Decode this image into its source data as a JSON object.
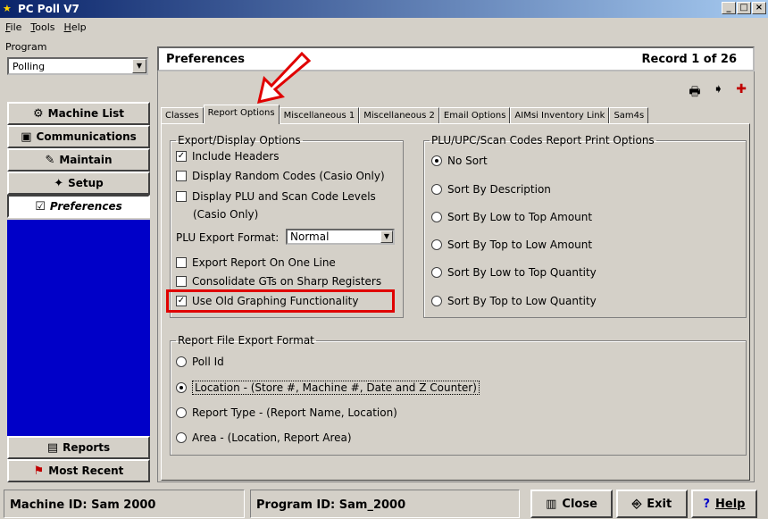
{
  "window": {
    "title": "PC Poll V7",
    "minimize": "_",
    "maximize": "□",
    "close": "×"
  },
  "menu": [
    "File",
    "Tools",
    "Help"
  ],
  "left": {
    "program_label": "Program",
    "program_value": "Polling",
    "nav": [
      "Machine List",
      "Communications",
      "Maintain",
      "Setup",
      "Preferences"
    ],
    "bottom_nav": [
      "Reports",
      "Most Recent"
    ]
  },
  "header": {
    "title": "Preferences",
    "record": "Record  1  of  26"
  },
  "tabs": [
    "Classes",
    "Report Options",
    "Miscellaneous 1",
    "Miscellaneous 2",
    "Email Options",
    "AIMsi Inventory Link",
    "Sam4s"
  ],
  "export_display": {
    "legend": "Export/Display Options",
    "include_headers": "Include Headers",
    "random_codes": "Display Random Codes (Casio Only)",
    "plu_levels_1": "Display PLU and Scan Code Levels",
    "plu_levels_2": "(Casio Only)",
    "plu_format_label": "PLU Export Format:",
    "plu_format_value": "Normal",
    "one_line": "Export Report On One Line",
    "consolidate": "Consolidate GTs on Sharp Registers",
    "old_graphing": "Use Old Graphing Functionality"
  },
  "plu_print": {
    "legend": "PLU/UPC/Scan Codes Report Print Options",
    "options": [
      "No Sort",
      "Sort By Description",
      "Sort By Low to Top Amount",
      "Sort By Top to Low Amount",
      "Sort By Low to Top Quantity",
      "Sort By Top to Low Quantity"
    ]
  },
  "file_export": {
    "legend": "Report File Export Format",
    "options": [
      "Poll Id",
      "Location - (Store #, Machine #, Date and Z Counter)",
      "Report Type - (Report Name, Location)",
      "Area - (Location, Report Area)"
    ]
  },
  "status": {
    "machine": "Machine ID: Sam 2000",
    "program": "Program ID: Sam_2000",
    "close": "Close",
    "exit": "Exit",
    "help": "Help"
  },
  "colors": {
    "title_start": "#0a246a",
    "title_end": "#a6caf0",
    "nav_blue": "#0000c8",
    "highlight": "#e00000"
  }
}
